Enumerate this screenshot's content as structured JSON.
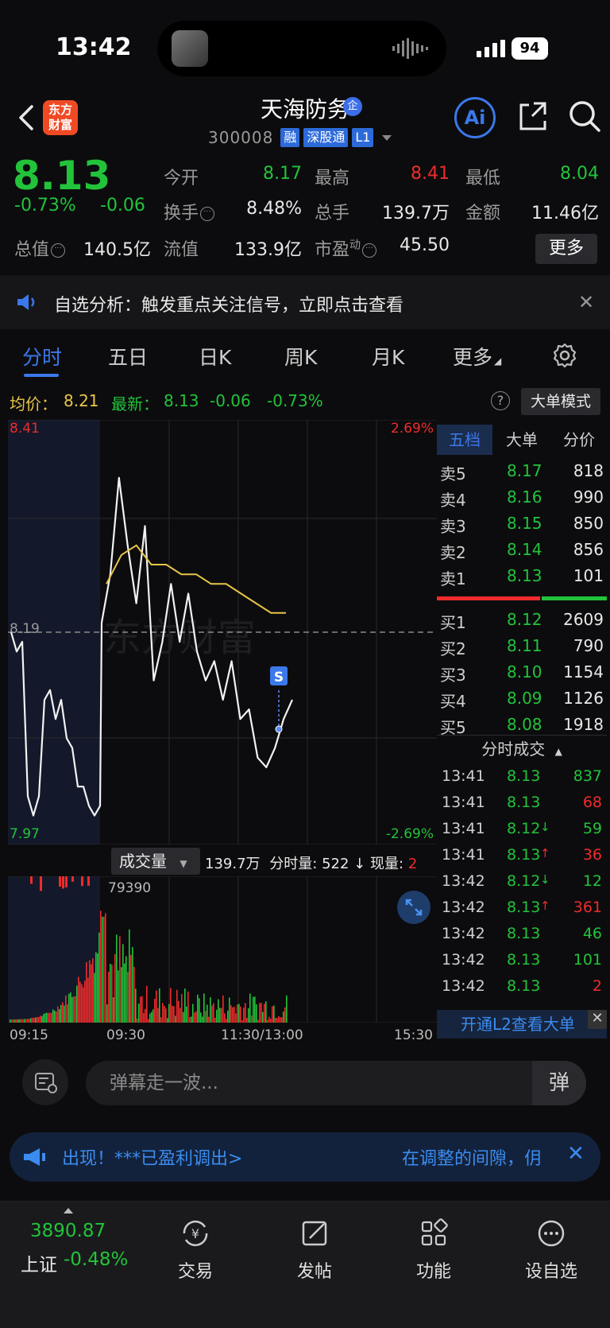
{
  "status_bar": {
    "time": "13:42",
    "battery": "94"
  },
  "header": {
    "logo_line1": "东方",
    "logo_line2": "财富",
    "stock_name": "天海防务",
    "name_badge": "企",
    "code": "300008",
    "tags": [
      "融",
      "深股通",
      "L1"
    ],
    "ai_label": "Ai"
  },
  "quote": {
    "price": "8.13",
    "change_pct": "-0.73%",
    "change_val": "-0.06",
    "fields": [
      {
        "label": "今开",
        "value": "8.17",
        "color": "green"
      },
      {
        "label": "最高",
        "value": "8.41",
        "color": "red"
      },
      {
        "label": "最低",
        "value": "8.04",
        "color": "green"
      },
      {
        "label": "换手",
        "value": "8.48%",
        "color": "white"
      },
      {
        "label": "总手",
        "value": "139.7万",
        "color": "white"
      },
      {
        "label": "金额",
        "value": "11.46亿",
        "color": "white"
      },
      {
        "label": "总值",
        "value": "140.5亿",
        "color": "white"
      },
      {
        "label": "流值",
        "value": "133.9亿",
        "color": "white"
      },
      {
        "label": "市盈",
        "value": "45.50",
        "color": "white"
      }
    ],
    "pe_superscript": "动",
    "more_label": "更多"
  },
  "notice": {
    "text": "自选分析：触发重点关注信号，立即点击查看",
    "close": "✕"
  },
  "tabs": [
    "分时",
    "五日",
    "日K",
    "周K",
    "月K",
    "更多"
  ],
  "avg_row": {
    "avg_label": "均价：",
    "avg_value": "8.21",
    "latest_label": "最新：",
    "latest_value": "8.13",
    "latest_chg": "-0.06",
    "latest_pct": "-0.73%",
    "help": "?",
    "mode_btn": "大单模式"
  },
  "chart": {
    "high_label": "8.41",
    "low_label": "7.97",
    "prev_close_label": "8.19",
    "up_pct": "2.69%",
    "down_pct": "-2.69%",
    "marker": "S",
    "watermark": "东方财富"
  },
  "chart_data": {
    "type": "line",
    "ylim": [
      7.97,
      8.41
    ],
    "prev_close": 8.19,
    "x_ticks": [
      "09:15",
      "09:30",
      "11:30/13:00",
      "15:30"
    ],
    "series": [
      {
        "values": [
          8.19,
          8.17,
          8.18,
          8.02,
          8.0,
          8.02,
          8.12,
          8.13,
          8.1,
          8.12,
          8.08,
          8.07,
          8.03,
          8.03,
          8.01,
          8.0,
          8.01,
          8.2,
          8.25,
          8.35,
          8.28,
          8.22,
          8.3,
          8.14,
          8.18,
          8.24,
          8.18,
          8.23,
          8.17,
          8.14,
          8.16,
          8.12,
          8.16,
          8.1,
          8.11,
          8.06,
          8.05,
          8.07,
          8.1,
          8.12
        ]
      },
      {
        "values": [
          8.24,
          8.27,
          8.28,
          8.26,
          8.26,
          8.25,
          8.25,
          8.24,
          8.24,
          8.23,
          8.22,
          8.21,
          8.21
        ]
      }
    ],
    "volume": {
      "label": "成交量",
      "total": "139.7万",
      "minute_label": "分时量:",
      "minute_value": "522",
      "current_label": "现量:",
      "current_value": "2",
      "peak_label": "79390"
    }
  },
  "order_book": {
    "tabs": [
      "五档",
      "大单",
      "分价"
    ],
    "asks": [
      {
        "label": "卖5",
        "price": "8.17",
        "vol": "818"
      },
      {
        "label": "卖4",
        "price": "8.16",
        "vol": "990"
      },
      {
        "label": "卖3",
        "price": "8.15",
        "vol": "850"
      },
      {
        "label": "卖2",
        "price": "8.14",
        "vol": "856"
      },
      {
        "label": "卖1",
        "price": "8.13",
        "vol": "101"
      }
    ],
    "bids": [
      {
        "label": "买1",
        "price": "8.12",
        "vol": "2609"
      },
      {
        "label": "买2",
        "price": "8.11",
        "vol": "790"
      },
      {
        "label": "买3",
        "price": "8.10",
        "vol": "1154"
      },
      {
        "label": "买4",
        "price": "8.09",
        "vol": "1126"
      },
      {
        "label": "买5",
        "price": "8.08",
        "vol": "1918"
      }
    ],
    "trades_header": "分时成交",
    "trades": [
      {
        "time": "13:41",
        "price": "8.13",
        "arrow": "",
        "vol": "837",
        "color": "green"
      },
      {
        "time": "13:41",
        "price": "8.13",
        "arrow": "",
        "vol": "68",
        "color": "red"
      },
      {
        "time": "13:41",
        "price": "8.12",
        "arrow": "↓",
        "vol": "59",
        "color": "green"
      },
      {
        "time": "13:41",
        "price": "8.13",
        "arrow": "↑",
        "vol": "36",
        "color": "red"
      },
      {
        "time": "13:42",
        "price": "8.12",
        "arrow": "↓",
        "vol": "12",
        "color": "green"
      },
      {
        "time": "13:42",
        "price": "8.13",
        "arrow": "↑",
        "vol": "361",
        "color": "red"
      },
      {
        "time": "13:42",
        "price": "8.13",
        "arrow": "",
        "vol": "46",
        "color": "green"
      },
      {
        "time": "13:42",
        "price": "8.13",
        "arrow": "",
        "vol": "101",
        "color": "green"
      },
      {
        "time": "13:42",
        "price": "8.13",
        "arrow": "",
        "vol": "2",
        "color": "red"
      }
    ],
    "l2_banner": "开通L2查看大单",
    "l2_close": "✕"
  },
  "danmu": {
    "placeholder": "弹幕走一波...",
    "send": "弹"
  },
  "ticker": {
    "left_text": "出现！***已盈利调出>",
    "right_text": "在调整的间隙，仴",
    "close": "✕"
  },
  "bottom_bar": {
    "index_value": "3890.87",
    "index_name": "上证",
    "index_change": "-0.48%",
    "items": [
      "交易",
      "发帖",
      "功能",
      "设自选"
    ]
  }
}
